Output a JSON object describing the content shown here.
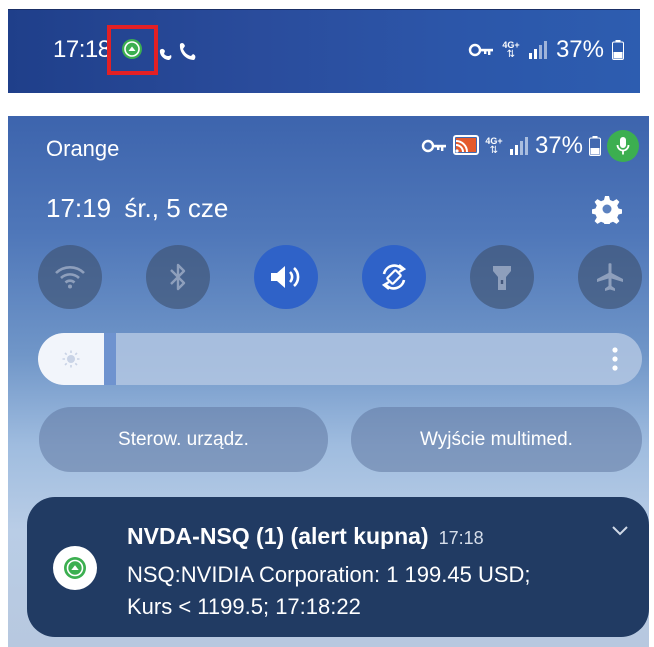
{
  "status_bar": {
    "time": "17:18",
    "battery": "37%",
    "network": "4G+"
  },
  "quick_panel": {
    "carrier": "Orange",
    "battery": "37%",
    "network": "4G+",
    "time": "17:19",
    "date": "śr., 5 cze",
    "toggles": [
      {
        "name": "wifi",
        "on": false
      },
      {
        "name": "bluetooth",
        "on": false
      },
      {
        "name": "sound",
        "on": true
      },
      {
        "name": "auto-rotate",
        "on": true
      },
      {
        "name": "flashlight",
        "on": false
      },
      {
        "name": "airplane-mode",
        "on": false
      }
    ],
    "brightness_level": 0.11,
    "buttons": {
      "devices": "Sterow. urządz.",
      "media": "Wyjście multimed."
    }
  },
  "notification": {
    "title": "NVDA-NSQ (1) (alert kupna)",
    "time": "17:18",
    "line1": "NSQ:NVIDIA Corporation: 1 199.45 USD;",
    "line2": "Kurs < 1199.5; 17:18:22"
  },
  "colors": {
    "highlight": "#e32025",
    "alert_green": "#3caf50",
    "notification_bg": "#213b63",
    "toggle_on": "#2f62c8"
  }
}
